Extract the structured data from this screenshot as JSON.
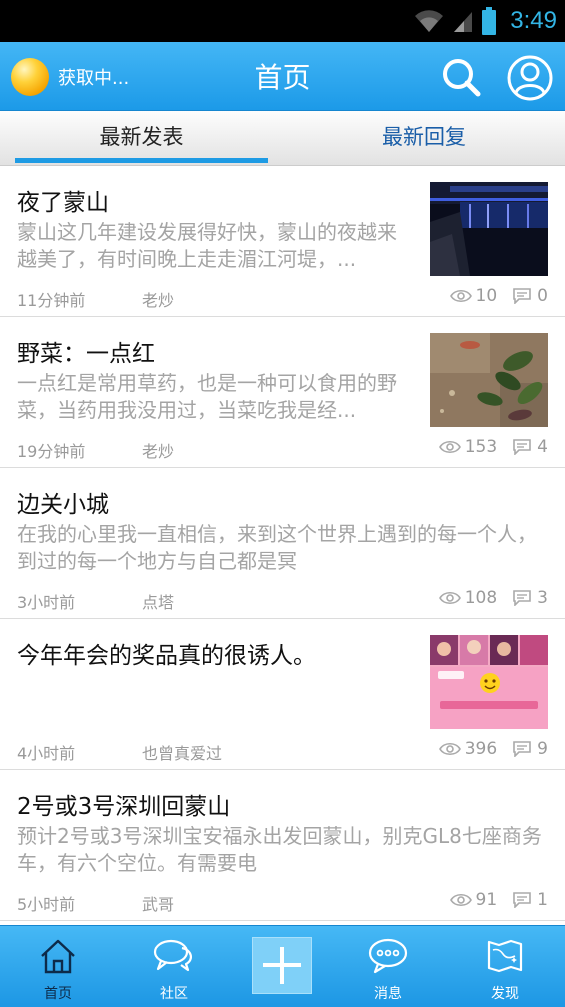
{
  "status_bar": {
    "time": "3:49"
  },
  "header": {
    "loading_text": "获取中...",
    "title": "首页"
  },
  "tabs": [
    {
      "label": "最新发表",
      "active": true
    },
    {
      "label": "最新回复",
      "active": false
    }
  ],
  "posts": [
    {
      "title": "夜了蒙山",
      "summary": "蒙山这几年建设发展得好快，蒙山的夜越来越美了，有时间晚上走走湄江河堤，...",
      "time": "11分钟前",
      "author": "老炒",
      "views": "10",
      "replies": "0",
      "thumbnail": "night-river"
    },
    {
      "title": "野菜：一点红",
      "summary": "一点红是常用草药，也是一种可以食用的野菜，当药用我没用过，当菜吃我是经...",
      "time": "19分钟前",
      "author": "老炒",
      "views": "153",
      "replies": "4",
      "thumbnail": "wild-plant"
    },
    {
      "title": "边关小城",
      "summary": "在我的心里我一直相信，来到这个世界上遇到的每一个人，到过的每一个地方与自己都是冥",
      "time": "3小时前",
      "author": "点塔",
      "views": "108",
      "replies": "3",
      "thumbnail": null
    },
    {
      "title": "今年年会的奖品真的很诱人。",
      "summary": "",
      "time": "4小时前",
      "author": "也曾真爱过",
      "views": "396",
      "replies": "9",
      "thumbnail": "prize-collage"
    },
    {
      "title": "2号或3号深圳回蒙山",
      "summary": "预计2号或3号深圳宝安福永出发回蒙山，别克GL8七座商务车，有六个空位。有需要电",
      "time": "5小时前",
      "author": "武哥",
      "views": "91",
      "replies": "1",
      "thumbnail": null
    }
  ],
  "bottom_nav": [
    {
      "label": "首页",
      "icon": "home-icon",
      "active": true
    },
    {
      "label": "社区",
      "icon": "chat-bubbles-icon",
      "active": false
    },
    {
      "label": "",
      "icon": "plus-icon",
      "active": false
    },
    {
      "label": "消息",
      "icon": "message-icon",
      "active": false
    },
    {
      "label": "发现",
      "icon": "map-icon",
      "active": false
    }
  ],
  "colors": {
    "accent": "#1e9be4",
    "header": "#2aa4ee",
    "tab_inactive": "#1a5ea8",
    "status_time": "#33b5e5"
  }
}
